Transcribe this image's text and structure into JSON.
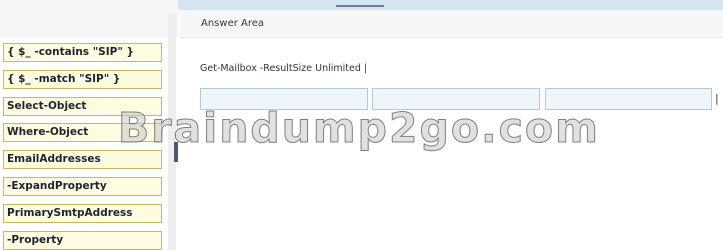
{
  "choices": [
    "{ $_ -contains \"SIP\" }",
    "{ $_ -match \"SIP\" }",
    "Select-Object",
    "Where-Object",
    "EmailAddresses",
    "-ExpandProperty",
    "PrimarySmtpAddress",
    "-Property"
  ],
  "answer_area": {
    "title": "Answer Area",
    "command": "Get-Mailbox -ResultSize Unlimited |",
    "trailing_pipe": "|"
  },
  "watermark": "Braindump2go.com",
  "colors": {
    "choice_fill": "#fffbe0",
    "choice_border": "#c9b95a",
    "slot_fill": "#eef5fb",
    "slot_border": "#b4c9dc",
    "top_bar": "#d6e4f1"
  }
}
